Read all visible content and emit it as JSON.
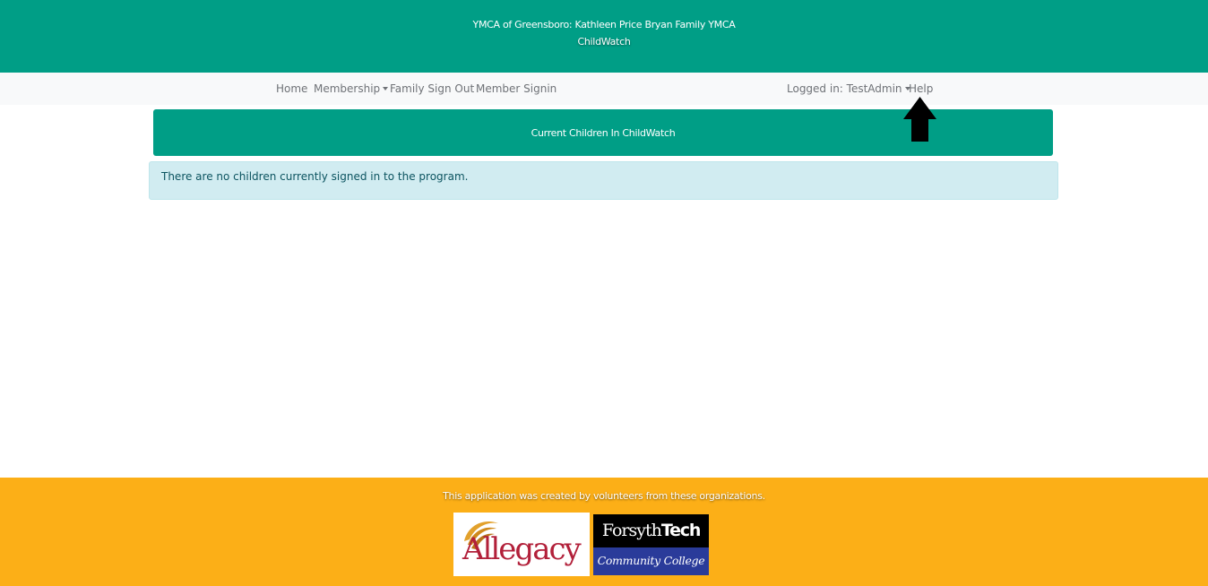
{
  "header": {
    "org_name": "YMCA of Greensboro: Kathleen Price Bryan Family YMCA",
    "app_name": "ChildWatch",
    "color": "#009e86"
  },
  "nav": {
    "home": "Home",
    "membership": "Membership",
    "family_sign_out": "Family Sign Out",
    "member_signin": "Member Signin",
    "logged_in": "Logged in: TestAdmin",
    "help": "Help"
  },
  "main": {
    "banner": "Current Children In ChildWatch",
    "alert": "There are no children currently signed in to the program."
  },
  "annotation": {
    "icon": "up-arrow-icon"
  },
  "footer": {
    "credit": "This application was created by volunteers from these organizations.",
    "color": "#fcaf17",
    "logos": {
      "allegacy": "Allegacy",
      "forsyth_top_a": "Forsyth",
      "forsyth_top_b": "Tech",
      "forsyth_bottom": "Community College"
    }
  }
}
